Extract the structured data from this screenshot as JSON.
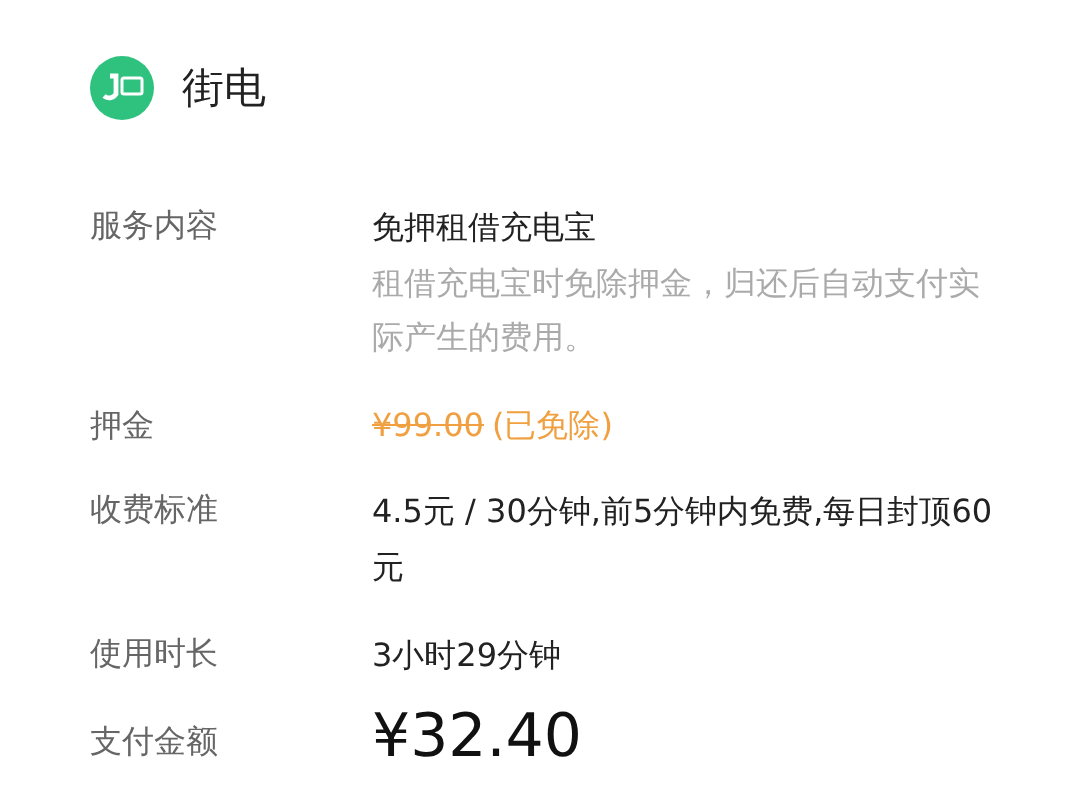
{
  "header": {
    "title": "街电"
  },
  "rows": [
    {
      "kind": "service",
      "label": "服务内容",
      "value": "免押租借充电宝",
      "description": "租借充电宝时免除押金，归还后自动支付实际产生的费用。"
    },
    {
      "kind": "deposit",
      "label": "押金",
      "value": "¥99.00",
      "note": "(已免除)"
    },
    {
      "kind": "text",
      "label": "收费标准",
      "value": "4.5元 / 30分钟,前5分钟内免费,每日封顶60元"
    },
    {
      "kind": "text",
      "label": "使用时长",
      "value": "3小时29分钟"
    },
    {
      "kind": "amount",
      "label": "支付金额",
      "value": "¥32.40"
    }
  ]
}
